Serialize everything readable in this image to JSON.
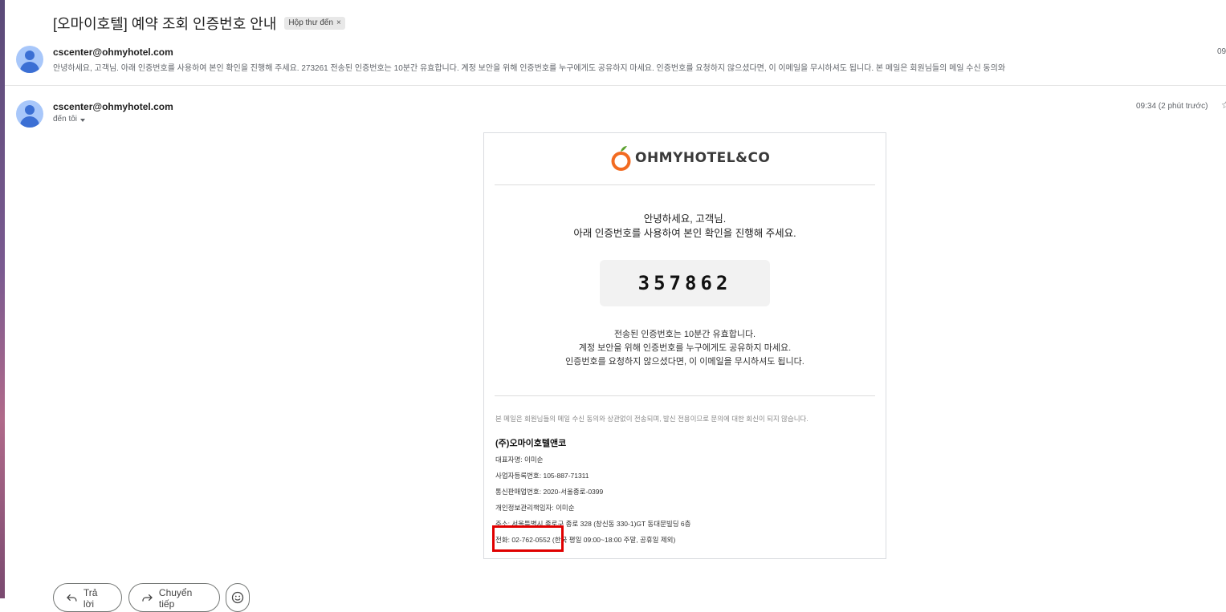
{
  "subject": {
    "title": "[오마이호텔] 예약 조회 인증번호 안내",
    "label": "Hộp thư đến",
    "label_close": "×"
  },
  "collapsed_message": {
    "sender": "cscenter@ohmyhotel.com",
    "snippet": "안녕하세요, 고객님. 아래 인증번호를 사용하여 본인 확인을 진행해 주세요. 273261 전송된 인증번호는 10분간 유효합니다. 계정 보안을 위해 인증번호를 누구에게도 공유하지 마세요. 인증번호를 요청하지 않으셨다면, 이 이메일을 무시하셔도 됩니다. 본 메일은 회원님들의 메일 수신 동의와",
    "time": "09"
  },
  "open_message": {
    "sender": "cscenter@ohmyhotel.com",
    "recipient": "đến tôi",
    "time": "09:34 (2 phút trước)"
  },
  "email_body": {
    "logo_text": "OHMYHOTEL&CO",
    "greeting_line1": "안녕하세요, 고객님.",
    "greeting_line2": "아래 인증번호를 사용하여 본인 확인을 진행해 주세요.",
    "code": "357862",
    "info_line1": "전송된 인증번호는 10분간 유효합니다.",
    "info_line2": "계정 보안을 위해 인증번호를 누구에게도 공유하지 마세요.",
    "info_line3": "인증번호를 요청하지 않으셨다면, 이 이메일을 무시하셔도 됩니다.",
    "notice": "본 메일은 회원님들의 메일 수신 동의와 상관없이 전송되며, 발신 전용이므로 문의에 대한 회신이 되지 않습니다.",
    "company_name": "(주)오마이호텔앤코",
    "ceo": "대표자명: 이미순",
    "business_no": "사업자등록번호: 105-887-71311",
    "ecommerce_no": "통신판매업번호: 2020-서울종로-0399",
    "privacy_officer": "개인정보관리책임자: 이미순",
    "address": "주소: 서울특별시 종로구 종로 328 (창신동 330-1)GT 동대문빌딩 6층",
    "phone": "전화: 02-762-0552 (한국 평일 09:00~18:00 주말, 공휴일 제외)"
  },
  "actions": {
    "reply": "Trả lời",
    "forward": "Chuyển tiếp"
  },
  "colors": {
    "highlight": "#e00000",
    "avatar_bg": "#a8c7fa",
    "logo_orange": "#f26b21",
    "logo_leaf": "#5aa02c"
  }
}
